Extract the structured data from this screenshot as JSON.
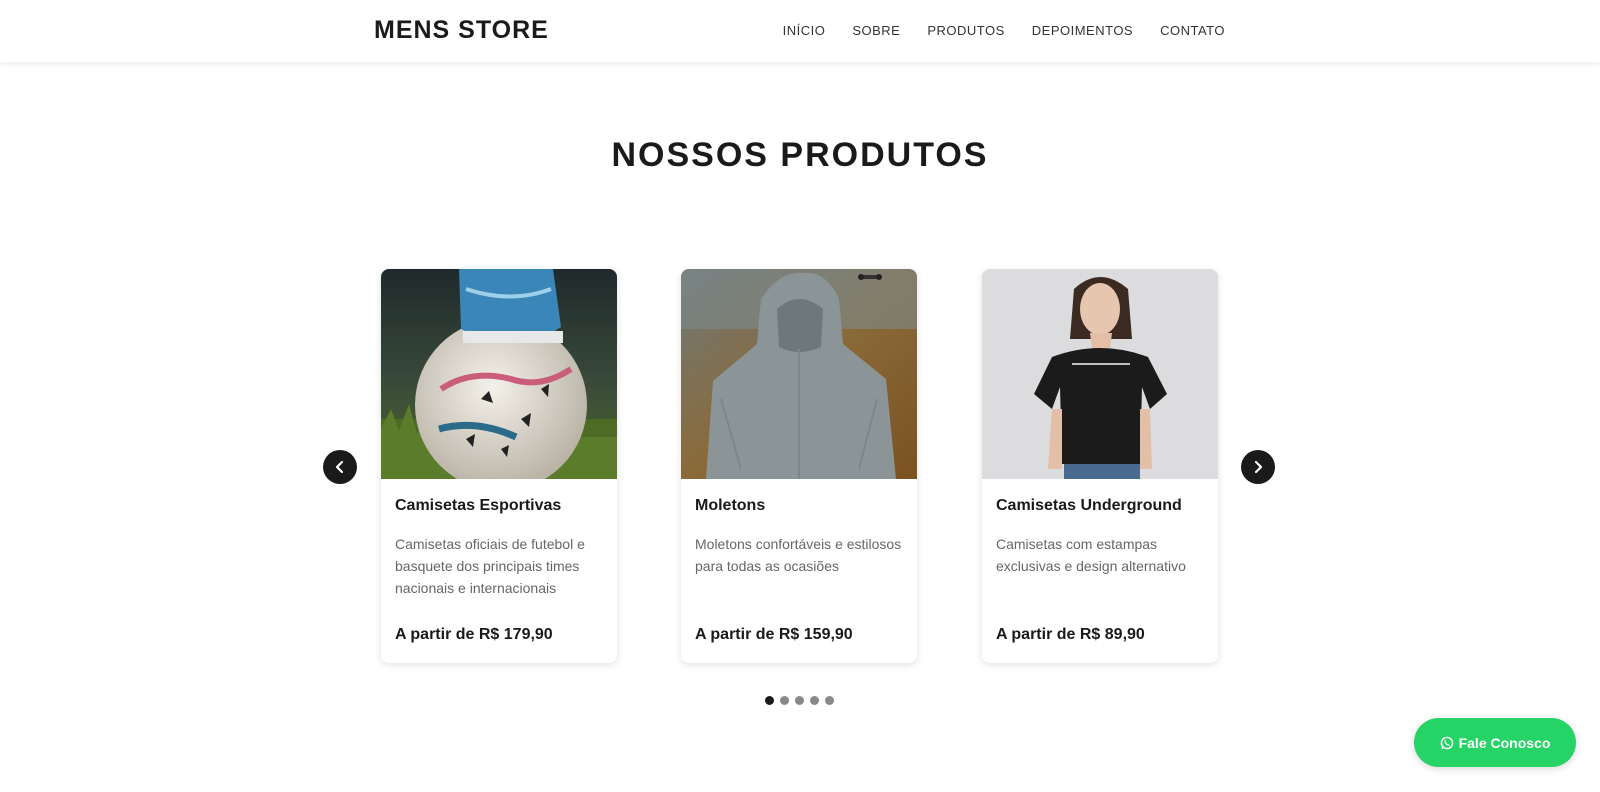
{
  "header": {
    "logo": "MENS STORE",
    "nav": [
      "INÍCIO",
      "SOBRE",
      "PRODUTOS",
      "DEPOIMENTOS",
      "CONTATO"
    ]
  },
  "section": {
    "title": "NOSSOS PRODUTOS"
  },
  "products": [
    {
      "title": "Camisetas Esportivas",
      "description": "Camisetas oficiais de futebol e basquete dos principais times nacionais e internacionais",
      "price": "A partir de R$ 179,90",
      "image_subject": "soccer-ball-photo"
    },
    {
      "title": "Moletons",
      "description": "Moletons confortáveis e estilosos para todas as ocasiões",
      "price": "A partir de R$ 159,90",
      "image_subject": "grey-hoodie-photo"
    },
    {
      "title": "Camisetas Underground",
      "description": "Camisetas com estampas exclusivas e design alternativo",
      "price": "A partir de R$ 89,90",
      "image_subject": "black-tshirt-photo"
    }
  ],
  "carousel": {
    "total_pages": 5,
    "active_page": 1
  },
  "whatsapp": {
    "label": "Fale Conosco",
    "color": "#25d366"
  },
  "colors": {
    "text": "#1a1a1a",
    "muted": "#666666",
    "accent": "#25d366"
  }
}
